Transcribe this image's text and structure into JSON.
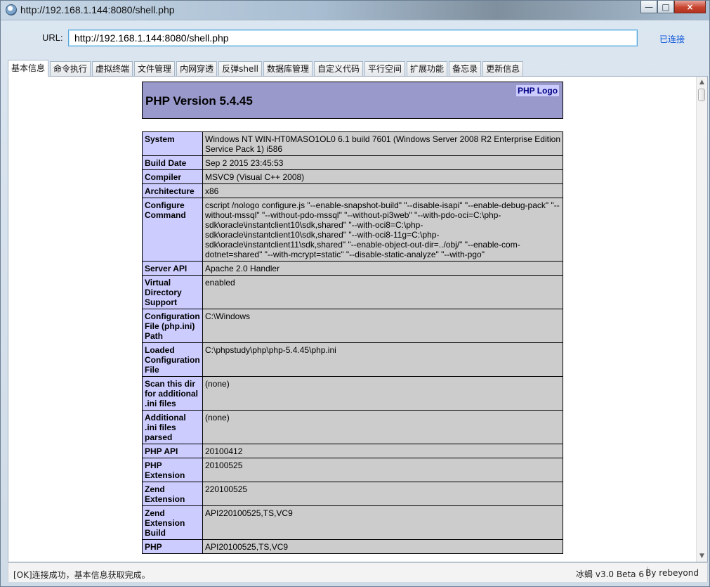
{
  "window": {
    "title": "http://192.168.1.144:8080/shell.php",
    "controls": {
      "minimize": "—",
      "maximize": "□",
      "close": "×"
    }
  },
  "toolbar": {
    "url_label": "URL:",
    "url_value": "http://192.168.1.144:8080/shell.php",
    "connection_status": "已连接"
  },
  "tabs": [
    "基本信息",
    "命令执行",
    "虚拟终端",
    "文件管理",
    "内网穿透",
    "反弹shell",
    "数据库管理",
    "自定义代码",
    "平行空间",
    "扩展功能",
    "备忘录",
    "更新信息"
  ],
  "phpinfo": {
    "version_title": "PHP Version 5.4.45",
    "logo_label": "PHP Logo",
    "rows": [
      {
        "key": "System",
        "value": "Windows NT WIN-HT0MASO1OL0 6.1 build 7601 (Windows Server 2008 R2 Enterprise Edition Service Pack 1) i586"
      },
      {
        "key": "Build Date",
        "value": "Sep 2 2015 23:45:53"
      },
      {
        "key": "Compiler",
        "value": "MSVC9 (Visual C++ 2008)"
      },
      {
        "key": "Architecture",
        "value": "x86"
      },
      {
        "key": "Configure Command",
        "value": "cscript /nologo configure.js \"--enable-snapshot-build\" \"--disable-isapi\" \"--enable-debug-pack\" \"--without-mssql\" \"--without-pdo-mssql\" \"--without-pi3web\" \"--with-pdo-oci=C:\\php-sdk\\oracle\\instantclient10\\sdk,shared\" \"--with-oci8=C:\\php-sdk\\oracle\\instantclient10\\sdk,shared\" \"--with-oci8-11g=C:\\php-sdk\\oracle\\instantclient11\\sdk,shared\" \"--enable-object-out-dir=../obj/\" \"--enable-com-dotnet=shared\" \"--with-mcrypt=static\" \"--disable-static-analyze\" \"--with-pgo\""
      },
      {
        "key": "Server API",
        "value": "Apache 2.0 Handler"
      },
      {
        "key": "Virtual Directory Support",
        "value": "enabled"
      },
      {
        "key": "Configuration File (php.ini) Path",
        "value": "C:\\Windows"
      },
      {
        "key": "Loaded Configuration File",
        "value": "C:\\phpstudy\\php\\php-5.4.45\\php.ini"
      },
      {
        "key": "Scan this dir for additional .ini files",
        "value": "(none)"
      },
      {
        "key": "Additional .ini files parsed",
        "value": "(none)"
      },
      {
        "key": "PHP API",
        "value": "20100412"
      },
      {
        "key": "PHP Extension",
        "value": "20100525"
      },
      {
        "key": "Zend Extension",
        "value": "220100525"
      },
      {
        "key": "Zend Extension Build",
        "value": "API220100525,TS,VC9"
      },
      {
        "key": "PHP",
        "value": "API20100525,TS,VC9"
      }
    ]
  },
  "scrollbar": {
    "up_arrow": "▲",
    "down_arrow": "▼"
  },
  "statusbar": {
    "message": "[OK]连接成功，基本信息获取完成。",
    "version": "冰蝎 v3.0 Beta 6",
    "author": "By rebeyond"
  },
  "colors": {
    "accent": "#3399ff",
    "phpHeader": "#9999cc",
    "phpKey": "#ccccff",
    "phpValue": "#cccccc",
    "connectionText": "#0b55d9"
  },
  "icons": {
    "app": "application-icon",
    "minimize": "minimize-icon",
    "maximize": "maximize-icon",
    "close": "close-icon",
    "scroll_up": "scroll-up-icon",
    "scroll_down": "scroll-down-icon"
  }
}
